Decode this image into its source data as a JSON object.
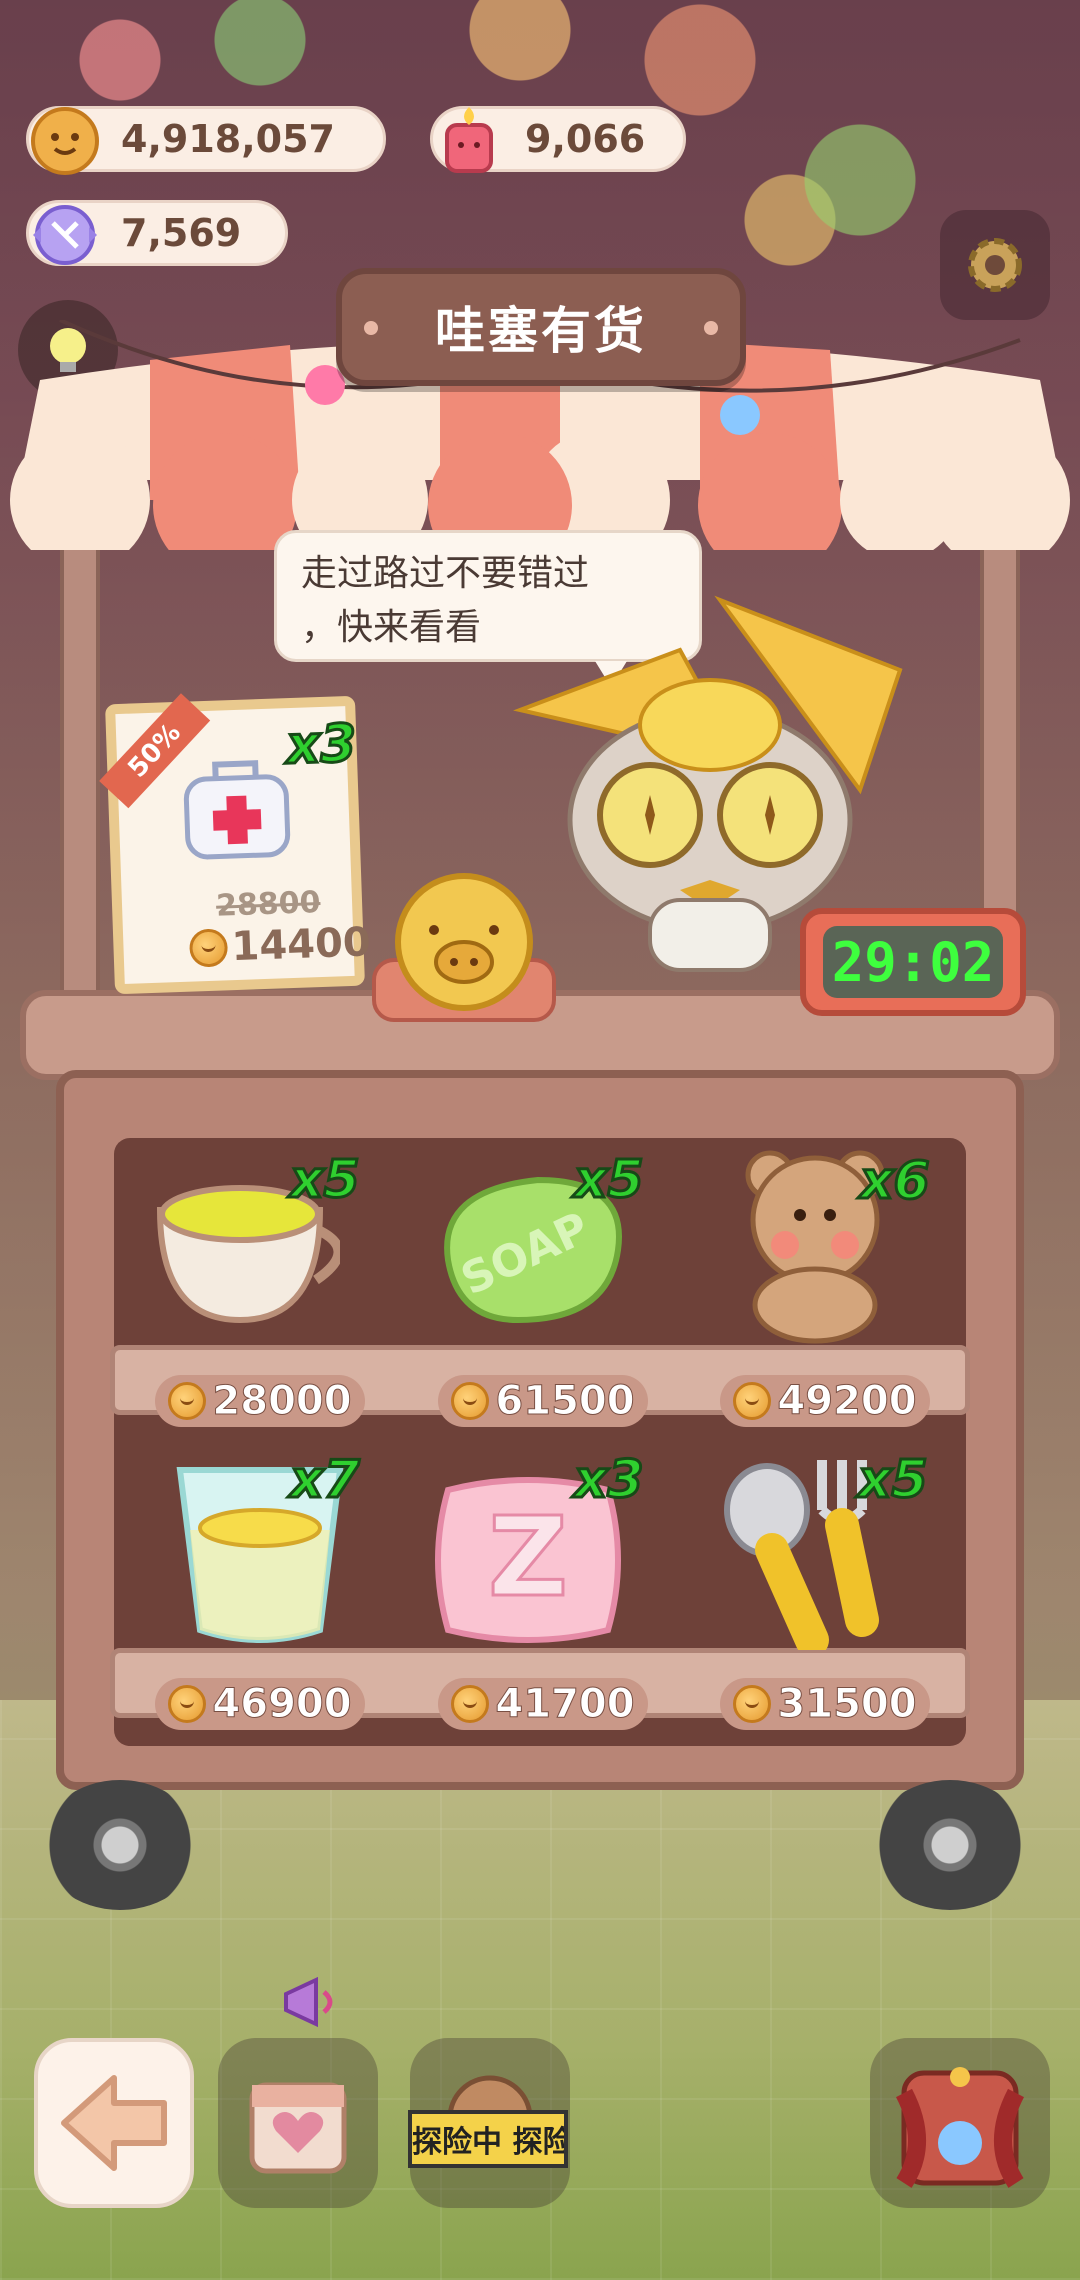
{
  "resources": {
    "cookies": "4,918,057",
    "candles": "9,066",
    "crystals": "7,569"
  },
  "shop": {
    "title": "哇塞有货",
    "speech_line1": "走过路过不要错过",
    "speech_line2": "，快来看看",
    "timer": "29:02"
  },
  "featured": {
    "icon": "first-aid-kit",
    "discount": "50%",
    "quantity": "x3",
    "old_price": "28800",
    "price": "14400"
  },
  "items": [
    {
      "icon": "tea-cup",
      "quantity": "x5",
      "price": "28000"
    },
    {
      "icon": "soap",
      "quantity": "x5",
      "price": "61500",
      "label": "SOAP"
    },
    {
      "icon": "teddy-bear",
      "quantity": "x6",
      "price": "49200"
    },
    {
      "icon": "lemon-water-glass",
      "quantity": "x7",
      "price": "46900"
    },
    {
      "icon": "sleep-pillow",
      "quantity": "x3",
      "price": "41700",
      "label": "Z"
    },
    {
      "icon": "spoon-fork",
      "quantity": "x5",
      "price": "31500"
    }
  ],
  "bottom": {
    "explore_tape": "探险中 探险"
  },
  "colors": {
    "qty_green": "#2fd02f",
    "timer_green": "#3eff3e",
    "awning_red": "#f08b78",
    "awning_cream": "#fbe7d6"
  }
}
